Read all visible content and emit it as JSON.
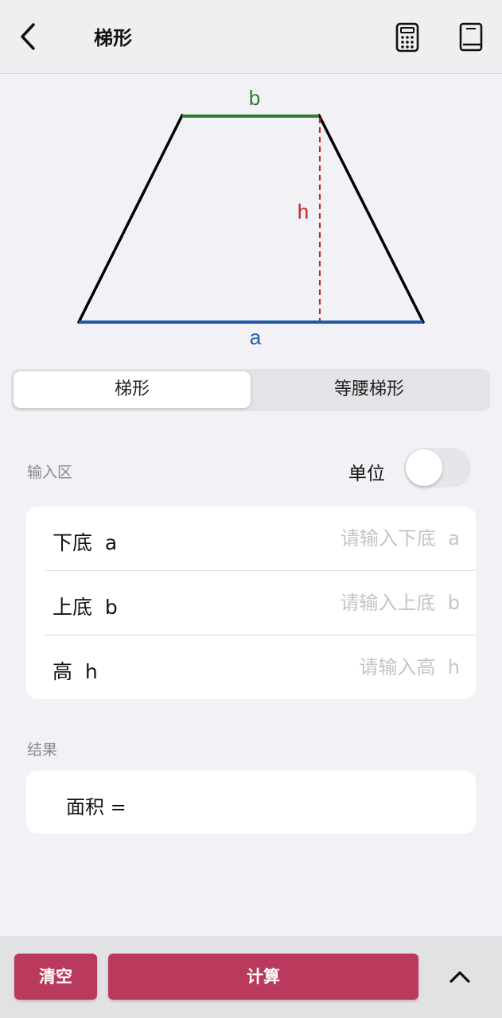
{
  "app_bar": {
    "title": "梯形",
    "icons": [
      "back-arrow-icon",
      "calculator-icon",
      "book-icon"
    ]
  },
  "figure": {
    "label_b": "b",
    "label_h": "h",
    "label_a": "a",
    "colors": {
      "top_base": "#2e7d32",
      "bottom_base": "#1e5aa8",
      "height": "#c62828",
      "sides": "#000000"
    }
  },
  "segmented": {
    "options": [
      "梯形",
      "等腰梯形"
    ],
    "selected": "梯形"
  },
  "input_section": {
    "label": "输入区",
    "unit_label": "单位",
    "unit_toggle_on": false,
    "rows": [
      {
        "label": "下底  a",
        "placeholder": "请输入下底  a",
        "value": ""
      },
      {
        "label": "上底  b",
        "placeholder": "请输入上底  b",
        "value": ""
      },
      {
        "label": "高  h",
        "placeholder": "请输入高  h",
        "value": ""
      }
    ]
  },
  "result_section": {
    "label": "结果",
    "area_text": "面积 ="
  },
  "bottom_bar": {
    "clear_label": "清空",
    "calculate_label": "计算",
    "accent_color": "#b93a5c",
    "expand_icon": "chevron-up-icon"
  }
}
